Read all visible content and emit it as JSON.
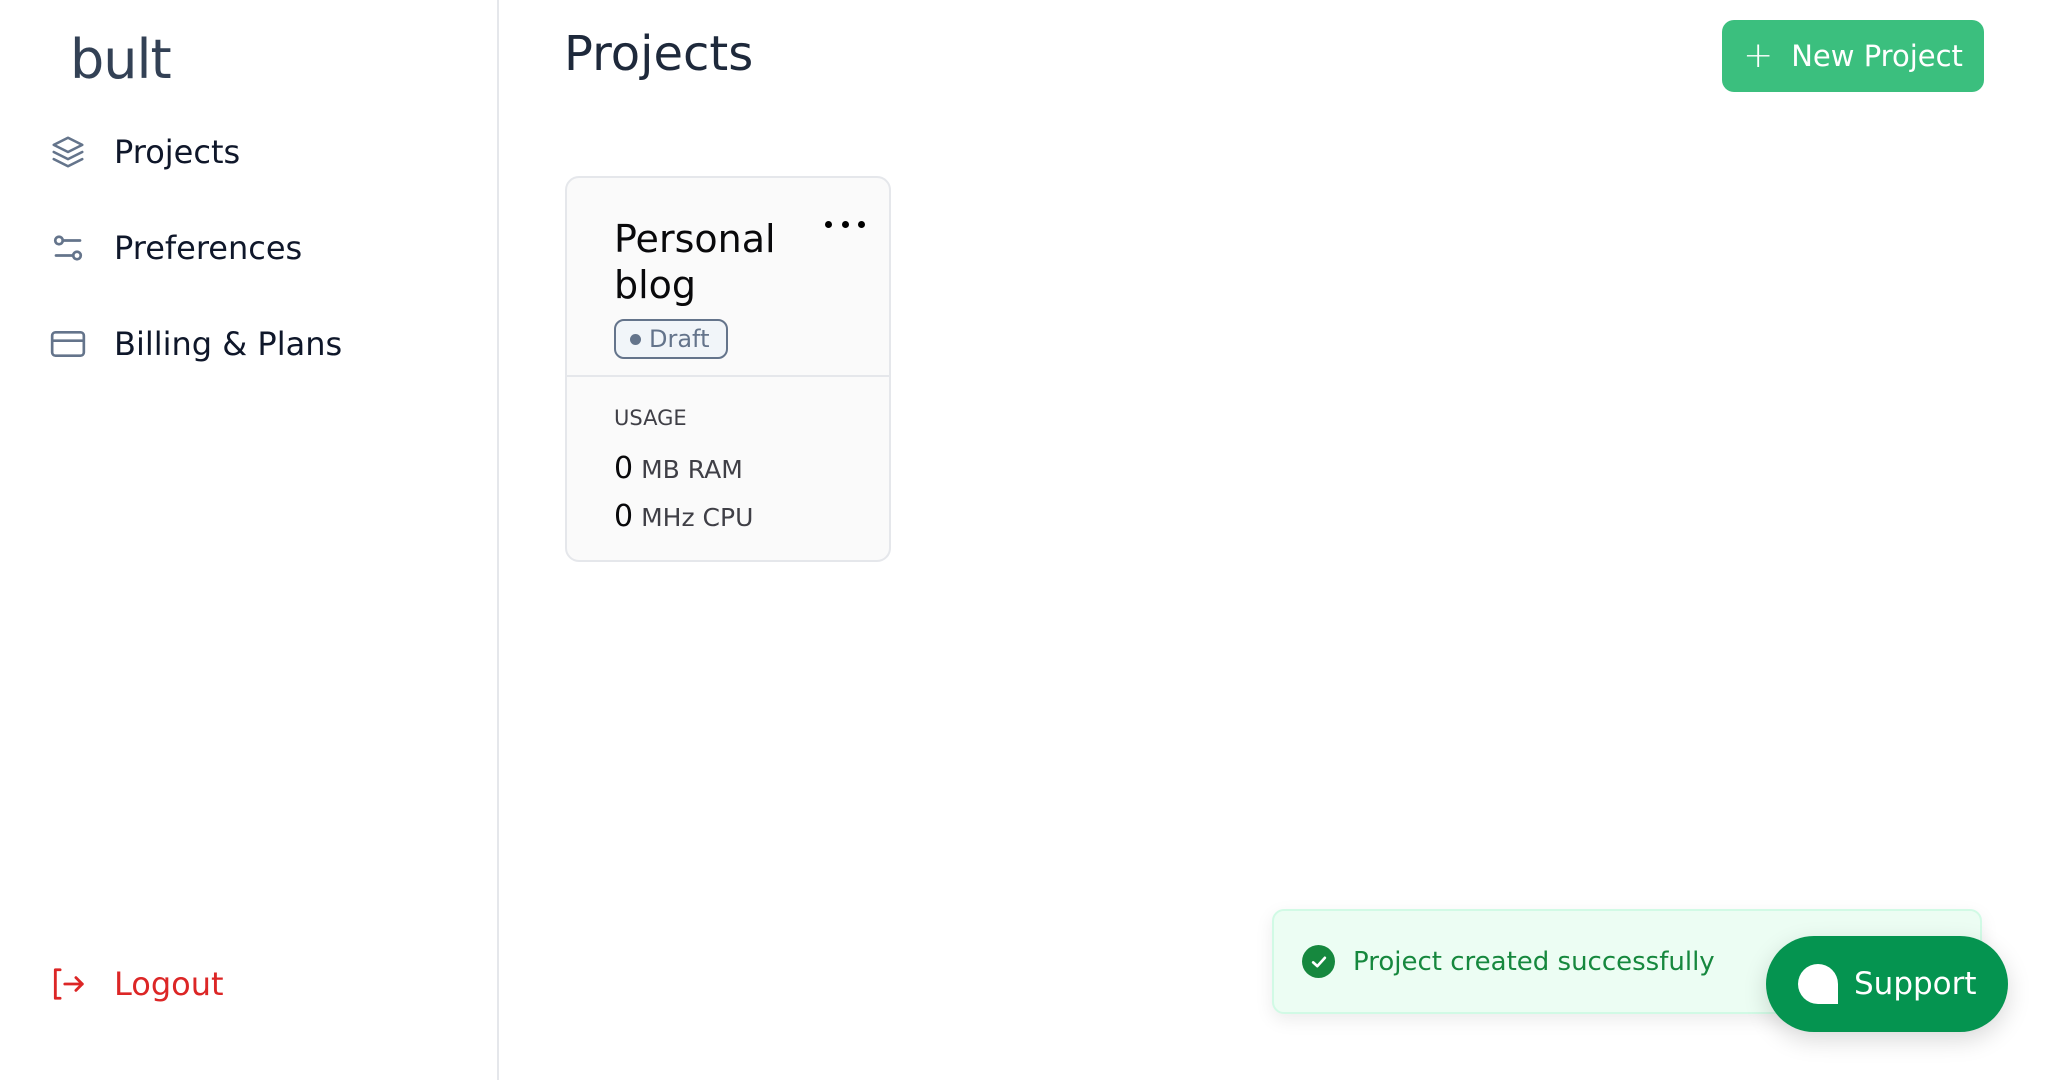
{
  "app": {
    "logo": "bult"
  },
  "sidebar": {
    "items": [
      {
        "label": "Projects",
        "icon": "layers-icon"
      },
      {
        "label": "Preferences",
        "icon": "sliders-icon"
      },
      {
        "label": "Billing & Plans",
        "icon": "credit-card-icon"
      }
    ],
    "logout": {
      "label": "Logout",
      "icon": "logout-icon",
      "color": "#dc2626"
    }
  },
  "header": {
    "title": "Projects",
    "new_project_button": {
      "label": "New Project",
      "icon": "plus-icon",
      "color": "#3bbf7e"
    }
  },
  "projects": [
    {
      "name": "Personal blog",
      "status": "Draft",
      "menu_icon": "more-horizontal-icon",
      "usage_label": "USAGE",
      "usage": [
        {
          "value": "0",
          "unit": "MB RAM"
        },
        {
          "value": "0",
          "unit": "MHz CPU"
        }
      ]
    }
  ],
  "toast": {
    "message": "Project created successfully",
    "icon": "check-circle-icon",
    "color": "#16883e"
  },
  "support": {
    "label": "Support",
    "icon": "chat-bubble-icon",
    "color": "#059450"
  }
}
